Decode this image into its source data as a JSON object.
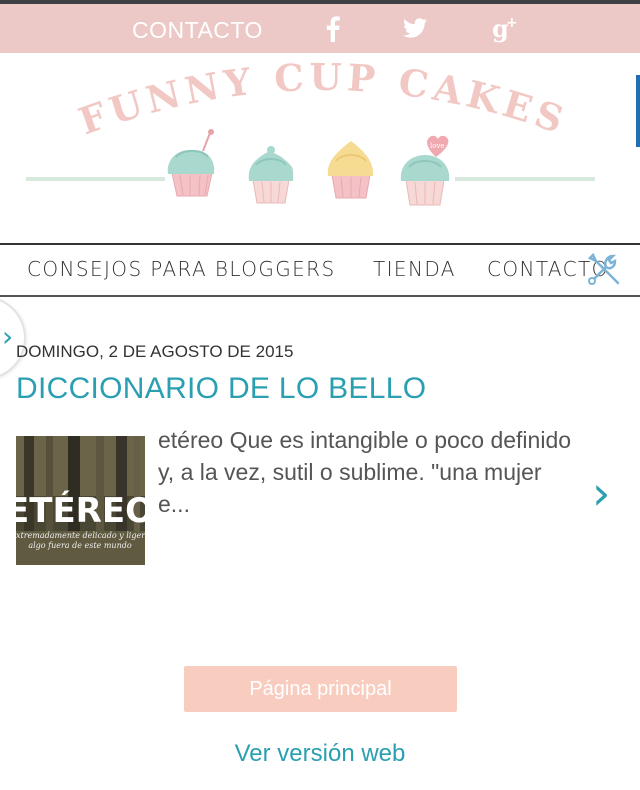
{
  "topbar": {
    "contact_label": "CONTACTO",
    "social": [
      "facebook-icon",
      "twitter-icon",
      "google-plus-icon"
    ],
    "bg_color": "#ecc9c6"
  },
  "banner": {
    "logo_text": "FUNNY CUP CAKES",
    "heart_text": "love"
  },
  "nav": {
    "items": [
      {
        "label": "CONSEJOS PARA BLOGGERS"
      },
      {
        "label": "TIENDA"
      },
      {
        "label": "CONTACTO"
      }
    ],
    "tools_icon": "tools-icon"
  },
  "post": {
    "date": "DOMINGO, 2 DE AGOSTO DE 2015",
    "title": "DICCIONARIO DE LO BELLO",
    "thumb_title": "ETÉREO",
    "thumb_subtitle_1": "Extremadamente delicado y ligero",
    "thumb_subtitle_2": "algo fuera de este mundo",
    "snippet": "etéreo Que es intangible o poco definido y, a la vez, sutil o sublime. \"una mujer e..."
  },
  "footer": {
    "home_label": "Página principal",
    "web_label": "Ver versión web"
  },
  "colors": {
    "accent": "#2a9fb1",
    "button": "#f8cdc0"
  }
}
